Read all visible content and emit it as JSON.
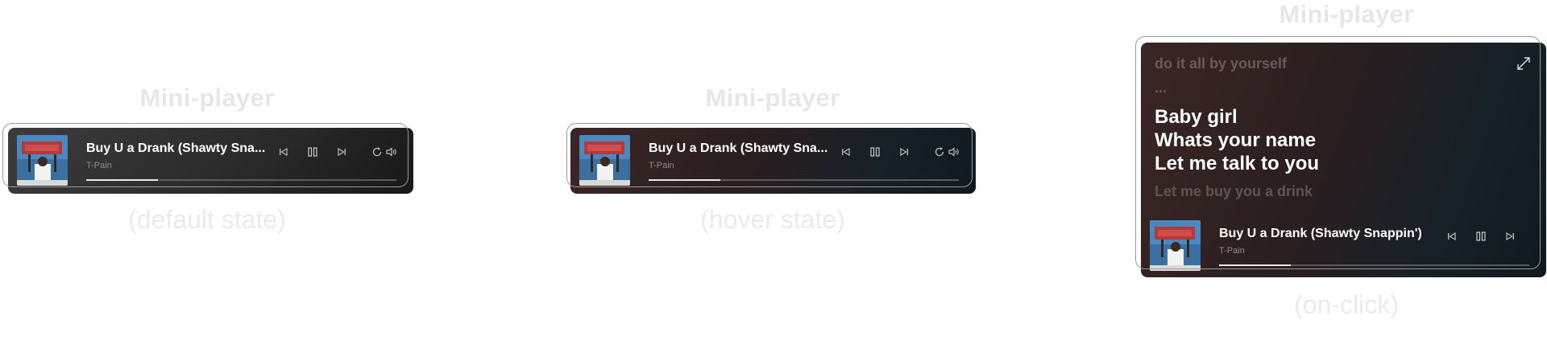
{
  "captions": {
    "default": {
      "title": "Mini-player",
      "state": "(default state)"
    },
    "hover": {
      "title": "Mini-player",
      "state": "(hover state)"
    },
    "click": {
      "title": "Mini-player",
      "state": "(on-click)"
    }
  },
  "track": {
    "title_truncated": "Buy U a Drank (Shawty Sna...",
    "title_full": "Buy U a Drank (Shawty Snappin')",
    "artist": "T-Pain",
    "progress": 0.23,
    "album_art": "album-cover-image"
  },
  "controls": {
    "previous": "skip-previous-icon",
    "pause": "pause-icon",
    "next": "skip-next-icon",
    "repeat": "repeat-icon",
    "volume": "volume-icon",
    "expand": "expand-icon"
  },
  "lyrics": {
    "previous_line": "do it all by yourself",
    "ellipsis": "...",
    "current_lines": [
      "Baby girl",
      "Whats your name",
      "Let me talk to you"
    ],
    "next_line": "Let me buy you a drink"
  },
  "colors": {
    "accent": "#ffffff",
    "muted_text": "#8d8d8d",
    "caption": "#e7e7e7"
  }
}
